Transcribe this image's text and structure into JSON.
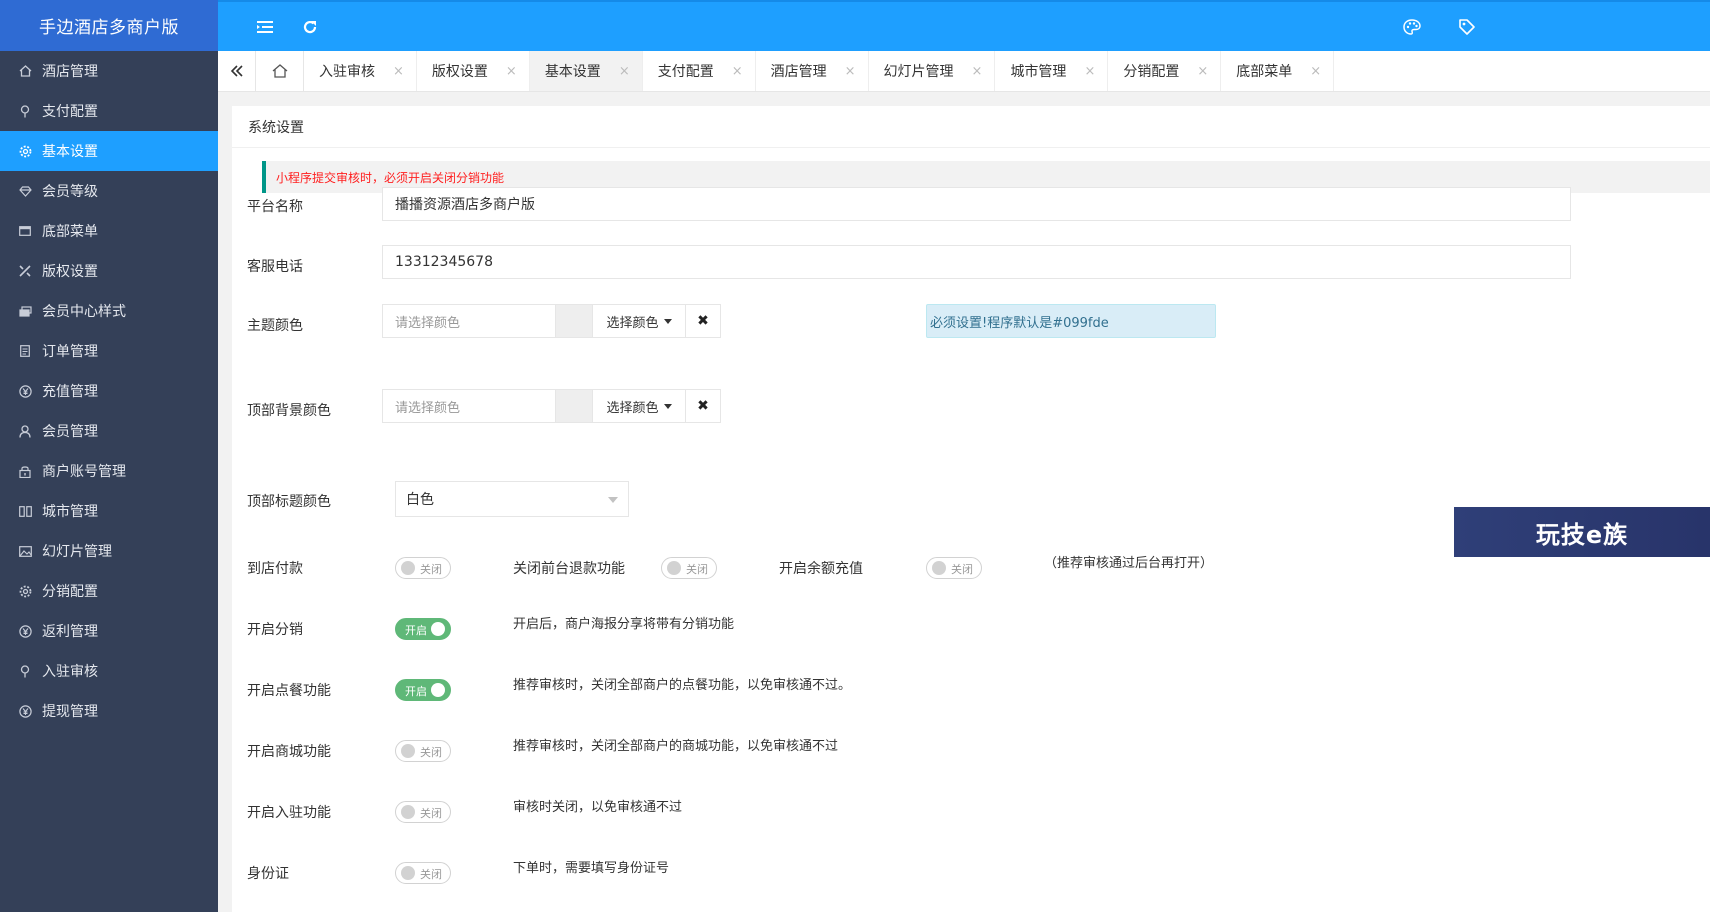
{
  "app": {
    "title": "手边酒店多商户版"
  },
  "sidebar": {
    "items": [
      {
        "label": "酒店管理",
        "icon": "home-icon"
      },
      {
        "label": "支付配置",
        "icon": "location-pin-icon"
      },
      {
        "label": "基本设置",
        "icon": "gear-icon",
        "active": true
      },
      {
        "label": "会员等级",
        "icon": "diamond-icon"
      },
      {
        "label": "底部菜单",
        "icon": "window-icon"
      },
      {
        "label": "版权设置",
        "icon": "tools-icon"
      },
      {
        "label": "会员中心样式",
        "icon": "layers-icon"
      },
      {
        "label": "订单管理",
        "icon": "document-icon"
      },
      {
        "label": "充值管理",
        "icon": "yen-icon"
      },
      {
        "label": "会员管理",
        "icon": "user-icon"
      },
      {
        "label": "商户账号管理",
        "icon": "lock-icon"
      },
      {
        "label": "城市管理",
        "icon": "columns-icon"
      },
      {
        "label": "幻灯片管理",
        "icon": "image-icon"
      },
      {
        "label": "分销配置",
        "icon": "gear-icon"
      },
      {
        "label": "返利管理",
        "icon": "yen-icon"
      },
      {
        "label": "入驻审核",
        "icon": "location-pin-icon"
      },
      {
        "label": "提现管理",
        "icon": "yen-icon"
      }
    ]
  },
  "header": {
    "menu_icon": "menu-fold-icon",
    "refresh_icon": "refresh-icon",
    "theme_icon": "palette-icon",
    "tag_icon": "tag-icon"
  },
  "tabs": {
    "items": [
      {
        "label": "入驻审核"
      },
      {
        "label": "版权设置"
      },
      {
        "label": "基本设置",
        "active": true
      },
      {
        "label": "支付配置"
      },
      {
        "label": "酒店管理"
      },
      {
        "label": "幻灯片管理"
      },
      {
        "label": "城市管理"
      },
      {
        "label": "分销配置"
      },
      {
        "label": "底部菜单"
      }
    ],
    "close_glyph": "×"
  },
  "form": {
    "panel_title": "系统设置",
    "warning": "小程序提交审核时，必须开启关闭分销功能",
    "platform_name": {
      "label": "平台名称",
      "value": "播播资源酒店多商户版"
    },
    "service_phone": {
      "label": "客服电话",
      "value": "13312345678"
    },
    "theme_color": {
      "label": "主题颜色",
      "placeholder": "请选择颜色",
      "button": "选择颜色",
      "clear": "✖",
      "hint": "必须设置!程序默认是#099fde"
    },
    "top_bg_color": {
      "label": "顶部背景颜色",
      "placeholder": "请选择颜色",
      "button": "选择颜色",
      "clear": "✖"
    },
    "top_title_color": {
      "label": "顶部标题颜色",
      "selected": "白色"
    },
    "pay_at_store": {
      "label": "到店付款",
      "state": "关闭",
      "on": false
    },
    "close_refund": {
      "label": "关闭前台退款功能",
      "state": "关闭",
      "on": false
    },
    "balance_recharge": {
      "label": "开启余额充值",
      "state": "关闭",
      "on": false
    },
    "recharge_note": "（推荐审核通过后台再打开）",
    "distribution": {
      "label": "开启分销",
      "state": "开启",
      "on": true,
      "note": "开启后，商户海报分享将带有分销功能"
    },
    "ordering": {
      "label": "开启点餐功能",
      "state": "开启",
      "on": true,
      "note": "推荐审核时，关闭全部商户的点餐功能，以免审核通不过。"
    },
    "mall": {
      "label": "开启商城功能",
      "state": "关闭",
      "on": false,
      "note": "推荐审核时，关闭全部商户的商城功能，以免审核通不过"
    },
    "settle_in": {
      "label": "开启入驻功能",
      "state": "关闭",
      "on": false,
      "note": "审核时关闭，以免审核通不过"
    },
    "id_card": {
      "label": "身份证",
      "state": "关闭",
      "on": false,
      "note": "下单时，需要填写身份证号"
    }
  },
  "watermark": "玩技e族",
  "colors": {
    "sidebar_bg": "#344058",
    "header_bg": "#1e9fff",
    "logo_bg": "#2f6bd3",
    "switch_on": "#5fb878",
    "warning_border": "#009688",
    "warning_text": "#ff2020"
  }
}
